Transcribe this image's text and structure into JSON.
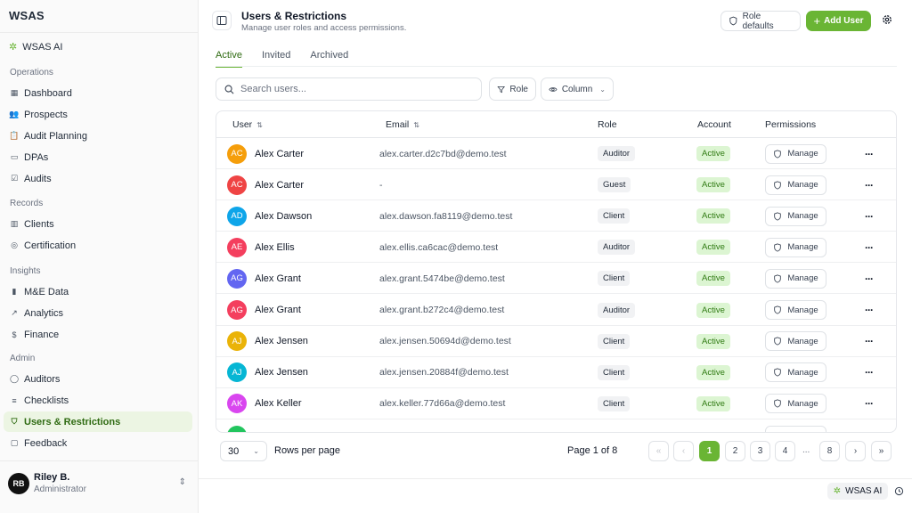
{
  "app": {
    "logo": "WSAS",
    "brand": "WSAS AI"
  },
  "sidebar": {
    "sections": [
      {
        "title": "Operations",
        "items": [
          {
            "label": "Dashboard",
            "icon": "grid-icon"
          },
          {
            "label": "Prospects",
            "icon": "users-icon"
          },
          {
            "label": "Audit Planning",
            "icon": "clipboard-icon"
          },
          {
            "label": "DPAs",
            "icon": "file-icon"
          },
          {
            "label": "Audits",
            "icon": "check-square-icon"
          }
        ]
      },
      {
        "title": "Records",
        "items": [
          {
            "label": "Clients",
            "icon": "building-icon"
          },
          {
            "label": "Certification",
            "icon": "badge-check-icon"
          }
        ]
      },
      {
        "title": "Insights",
        "items": [
          {
            "label": "M&E Data",
            "icon": "bar-chart-icon"
          },
          {
            "label": "Analytics",
            "icon": "line-chart-icon"
          },
          {
            "label": "Finance",
            "icon": "dollar-icon"
          }
        ]
      },
      {
        "title": "Admin",
        "items": [
          {
            "label": "Auditors",
            "icon": "user-icon"
          },
          {
            "label": "Checklists",
            "icon": "list-checks-icon"
          },
          {
            "label": "Users & Restrictions",
            "icon": "shield-icon",
            "active": true
          },
          {
            "label": "Feedback",
            "icon": "message-icon"
          }
        ]
      }
    ],
    "user": {
      "initials": "RB",
      "name": "Riley B.",
      "role": "Administrator"
    }
  },
  "header": {
    "title": "Users & Restrictions",
    "subtitle": "Manage user roles and access permissions.",
    "role_defaults": "Role defaults",
    "add_user": "Add User"
  },
  "tabs": [
    {
      "label": "Active",
      "active": true
    },
    {
      "label": "Invited"
    },
    {
      "label": "Archived"
    }
  ],
  "toolbar": {
    "search_placeholder": "Search users...",
    "role_filter": "Role",
    "column_toggle": "Column"
  },
  "table": {
    "columns": {
      "user": "User",
      "email": "Email",
      "role": "Role",
      "account": "Account",
      "permissions": "Permissions"
    },
    "manage_label": "Manage",
    "rows": [
      {
        "initials": "AC",
        "name": "Alex Carter",
        "email": "alex.carter.d2c7bd@demo.test",
        "role": "Auditor",
        "account": "Active",
        "color": "#f59e0b"
      },
      {
        "initials": "AC",
        "name": "Alex Carter",
        "email": "-",
        "role": "Guest",
        "account": "Active",
        "color": "#ef4444"
      },
      {
        "initials": "AD",
        "name": "Alex Dawson",
        "email": "alex.dawson.fa8119@demo.test",
        "role": "Client",
        "account": "Active",
        "color": "#0ea5e9"
      },
      {
        "initials": "AE",
        "name": "Alex Ellis",
        "email": "alex.ellis.ca6cac@demo.test",
        "role": "Auditor",
        "account": "Active",
        "color": "#f43f5e"
      },
      {
        "initials": "AG",
        "name": "Alex Grant",
        "email": "alex.grant.5474be@demo.test",
        "role": "Client",
        "account": "Active",
        "color": "#6366f1"
      },
      {
        "initials": "AG",
        "name": "Alex Grant",
        "email": "alex.grant.b272c4@demo.test",
        "role": "Auditor",
        "account": "Active",
        "color": "#f43f5e"
      },
      {
        "initials": "AJ",
        "name": "Alex Jensen",
        "email": "alex.jensen.50694d@demo.test",
        "role": "Client",
        "account": "Active",
        "color": "#eab308"
      },
      {
        "initials": "AJ",
        "name": "Alex Jensen",
        "email": "alex.jensen.20884f@demo.test",
        "role": "Client",
        "account": "Active",
        "color": "#06b6d4"
      },
      {
        "initials": "AK",
        "name": "Alex Keller",
        "email": "alex.keller.77d66a@demo.test",
        "role": "Client",
        "account": "Active",
        "color": "#d946ef"
      }
    ]
  },
  "pagination": {
    "rows_per_page_value": "30",
    "rows_per_page_label": "Rows per page",
    "page_info": "Page 1 of 8",
    "pages": [
      "1",
      "2",
      "3",
      "4"
    ],
    "ellipsis": "...",
    "last_page": "8"
  },
  "footer": {
    "ai_chip": "WSAS AI"
  },
  "colors": {
    "accent": "#6ab534",
    "accent_dark": "#2f6b12",
    "active_badge_bg": "#dcf5d2"
  }
}
